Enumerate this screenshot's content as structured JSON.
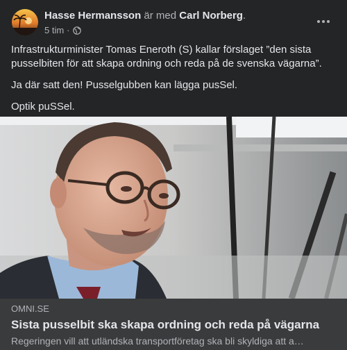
{
  "post": {
    "author": "Hasse Hermansson",
    "with_text": "är med",
    "tagged": "Carl Norberg",
    "period": ".",
    "time": "5 tim",
    "separator": "·",
    "privacy_icon": "globe-icon",
    "more_icon": "more-options-icon",
    "paragraphs": [
      "Infrastrukturminister Tomas Eneroth (S) kallar förslaget ”den sista pusselbiten för att skapa ordning och reda på de svenska vägarna”.",
      "Ja där satt den! Pusselgubben kan lägga pusSel.",
      "Optik puSSel."
    ]
  },
  "link": {
    "domain": "OMNI.SE",
    "title": "Sista pusselbit ska skapa ordning och reda på vägarna",
    "description": "Regeringen vill att utländska transportföretag ska bli skyldiga att a…"
  },
  "colors": {
    "background": "#242526",
    "link_box": "#3a3b3c",
    "text_primary": "#e4e6eb",
    "text_secondary": "#b0b3b8"
  }
}
